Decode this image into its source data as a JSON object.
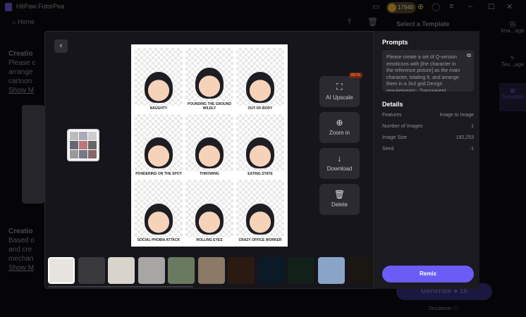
{
  "app": {
    "title": "HitPaw FotorPea",
    "credits": "17948"
  },
  "nav": {
    "home": "Home"
  },
  "background": {
    "select_template": "Select a Template",
    "creation1_title": "Creatio",
    "creation1_text": [
      "Please c",
      "arrange",
      "cartoon"
    ],
    "show_more": "Show M",
    "creation2_title": "Creatio",
    "creation2_text": [
      "Based o",
      "and cre",
      "mechan"
    ],
    "side_items": [
      "Ima...age",
      "Tex...age",
      "Template"
    ],
    "generate": "Generate",
    "generate_cost": "16",
    "disclaimer": "Disclaimer"
  },
  "viewer": {
    "stickers": [
      "NAUGHTY",
      "POUNDING THE GROUND WILDLY",
      "OUT-OF-BODY",
      "PONDERING ON THE SPOT",
      "THROWING",
      "EATING STATE",
      "SOCIAL PHOBIA ATTACK",
      "ROLLING EYES",
      "CRAZY OFFICE WORKER"
    ],
    "tools": [
      {
        "label": "AI Upscale",
        "badge": "BETA"
      },
      {
        "label": "Zoom in"
      },
      {
        "label": "Download"
      },
      {
        "label": "Delete"
      }
    ],
    "thumbnail_colors": [
      "#e8e4e0",
      "#3a3a3e",
      "#d8d4cc",
      "#a8a6a4",
      "#6a7a60",
      "#8a7a66",
      "#2a1a12",
      "#0a1a26",
      "#12201a",
      "#8aa4c8",
      "#1a1612"
    ]
  },
  "panel": {
    "prompts_title": "Prompts",
    "prompt": "Please create a set of Q-version emoticons with [the character in the reference picture] as the main character, totaling 9, and arrange them in a 3x3 grid.Design requirements:- Transparent",
    "details_title": "Details",
    "details": [
      {
        "k": "Features",
        "v": "Image to Image"
      },
      {
        "k": "Number of Images",
        "v": "1"
      },
      {
        "k": "Image Size",
        "v": "192,253"
      },
      {
        "k": "Seed",
        "v": "-1"
      }
    ],
    "remix": "Remix"
  },
  "colors": {
    "accent": "#6c5cf6"
  }
}
